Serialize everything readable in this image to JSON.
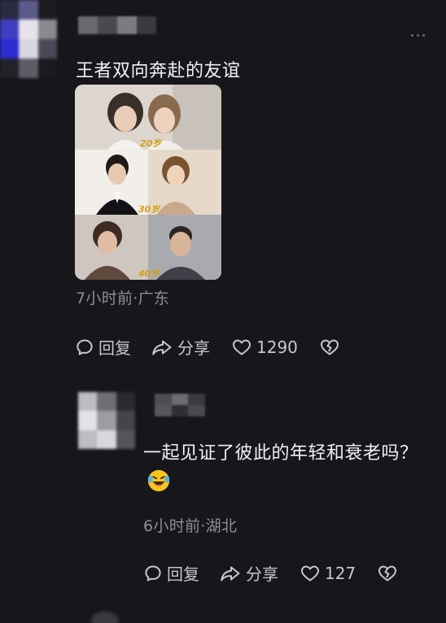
{
  "colors": {
    "background": "#17161b",
    "text_primary": "#f1f1f3",
    "text_meta": "#8f8e96",
    "icon": "#c8c7ce"
  },
  "comment1": {
    "text": "王者双向奔赴的友谊",
    "photo_labels": [
      "20岁",
      "30岁",
      "40岁"
    ],
    "meta": "7小时前·广东",
    "actions": {
      "reply_label": "回复",
      "share_label": "分享",
      "like_count": "1290"
    }
  },
  "comment2": {
    "text": "一起见证了彼此的年轻和衰老吗？",
    "emoji": "rolling-on-floor-laughing",
    "meta": "6小时前·湖北",
    "actions": {
      "reply_label": "回复",
      "share_label": "分享",
      "like_count": "127"
    }
  },
  "icons": {
    "reply": "speech-bubble-icon",
    "share": "share-arrow-icon",
    "like": "heart-outline-icon",
    "dislike": "broken-heart-icon",
    "more": "more-dots-icon"
  }
}
